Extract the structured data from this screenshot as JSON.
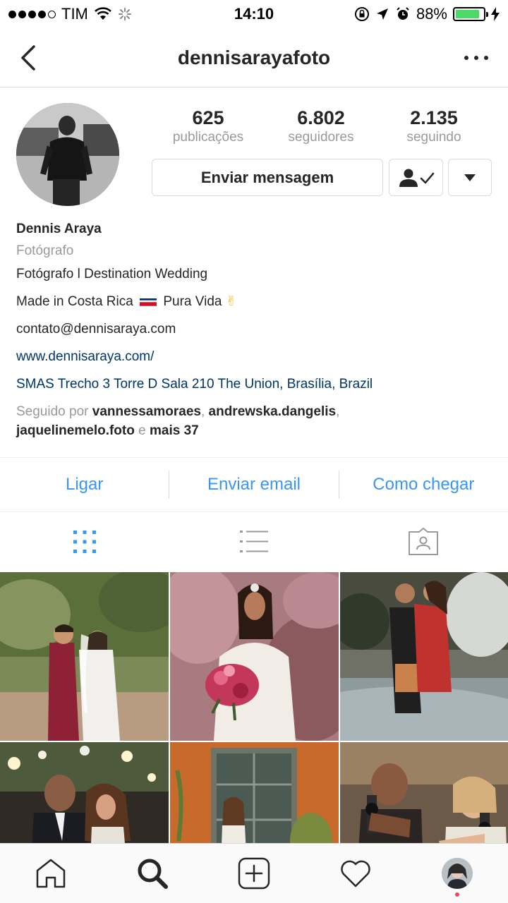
{
  "status_bar": {
    "carrier": "TIM",
    "time": "14:10",
    "battery": "88%",
    "battery_level": 0.88
  },
  "nav": {
    "title": "dennisarayafoto"
  },
  "profile": {
    "stats": [
      {
        "value": "625",
        "label": "publicações"
      },
      {
        "value": "6.802",
        "label": "seguidores"
      },
      {
        "value": "2.135",
        "label": "seguindo"
      }
    ],
    "message_button": "Enviar mensagem"
  },
  "bio": {
    "name": "Dennis Araya",
    "category": "Fotógrafo",
    "line1": "Fotógrafo l Destination Wedding",
    "line2_a": "Made in Costa Rica",
    "line2_b": "Pura Vida",
    "line2_emoji": "✌",
    "email": "contato@dennisaraya.com",
    "website": "www.dennisaraya.com/",
    "address": "SMAS Trecho 3 Torre D Sala 210 The Union, Brasília, Brazil",
    "followed_by_prefix": "Seguido por",
    "followed_user1": "vannessamoraes",
    "comma1": ",",
    "followed_user2": "andrewska.dangelis",
    "comma2": ",",
    "followed_user3": "jaquelinemelo.foto",
    "and_word": "e",
    "more": "mais 37"
  },
  "contact": {
    "call": "Ligar",
    "email": "Enviar email",
    "directions": "Como chegar"
  },
  "icons": {
    "back": "chevron-left-icon",
    "more": "more-horizontal-icon",
    "follow_status": "user-check-icon",
    "dropdown": "triangle-down-icon",
    "grid": "grid-view-icon",
    "list": "list-view-icon",
    "tagged": "tagged-photos-icon",
    "home": "home-icon",
    "search": "search-icon",
    "add": "add-post-icon",
    "activity": "heart-icon"
  },
  "colors": {
    "link_blue": "#3897f0",
    "address_blue": "#003569",
    "muted": "#999999",
    "border": "#dbdbdb",
    "battery_green": "#4cd964",
    "notify_red": "#ed4956"
  }
}
